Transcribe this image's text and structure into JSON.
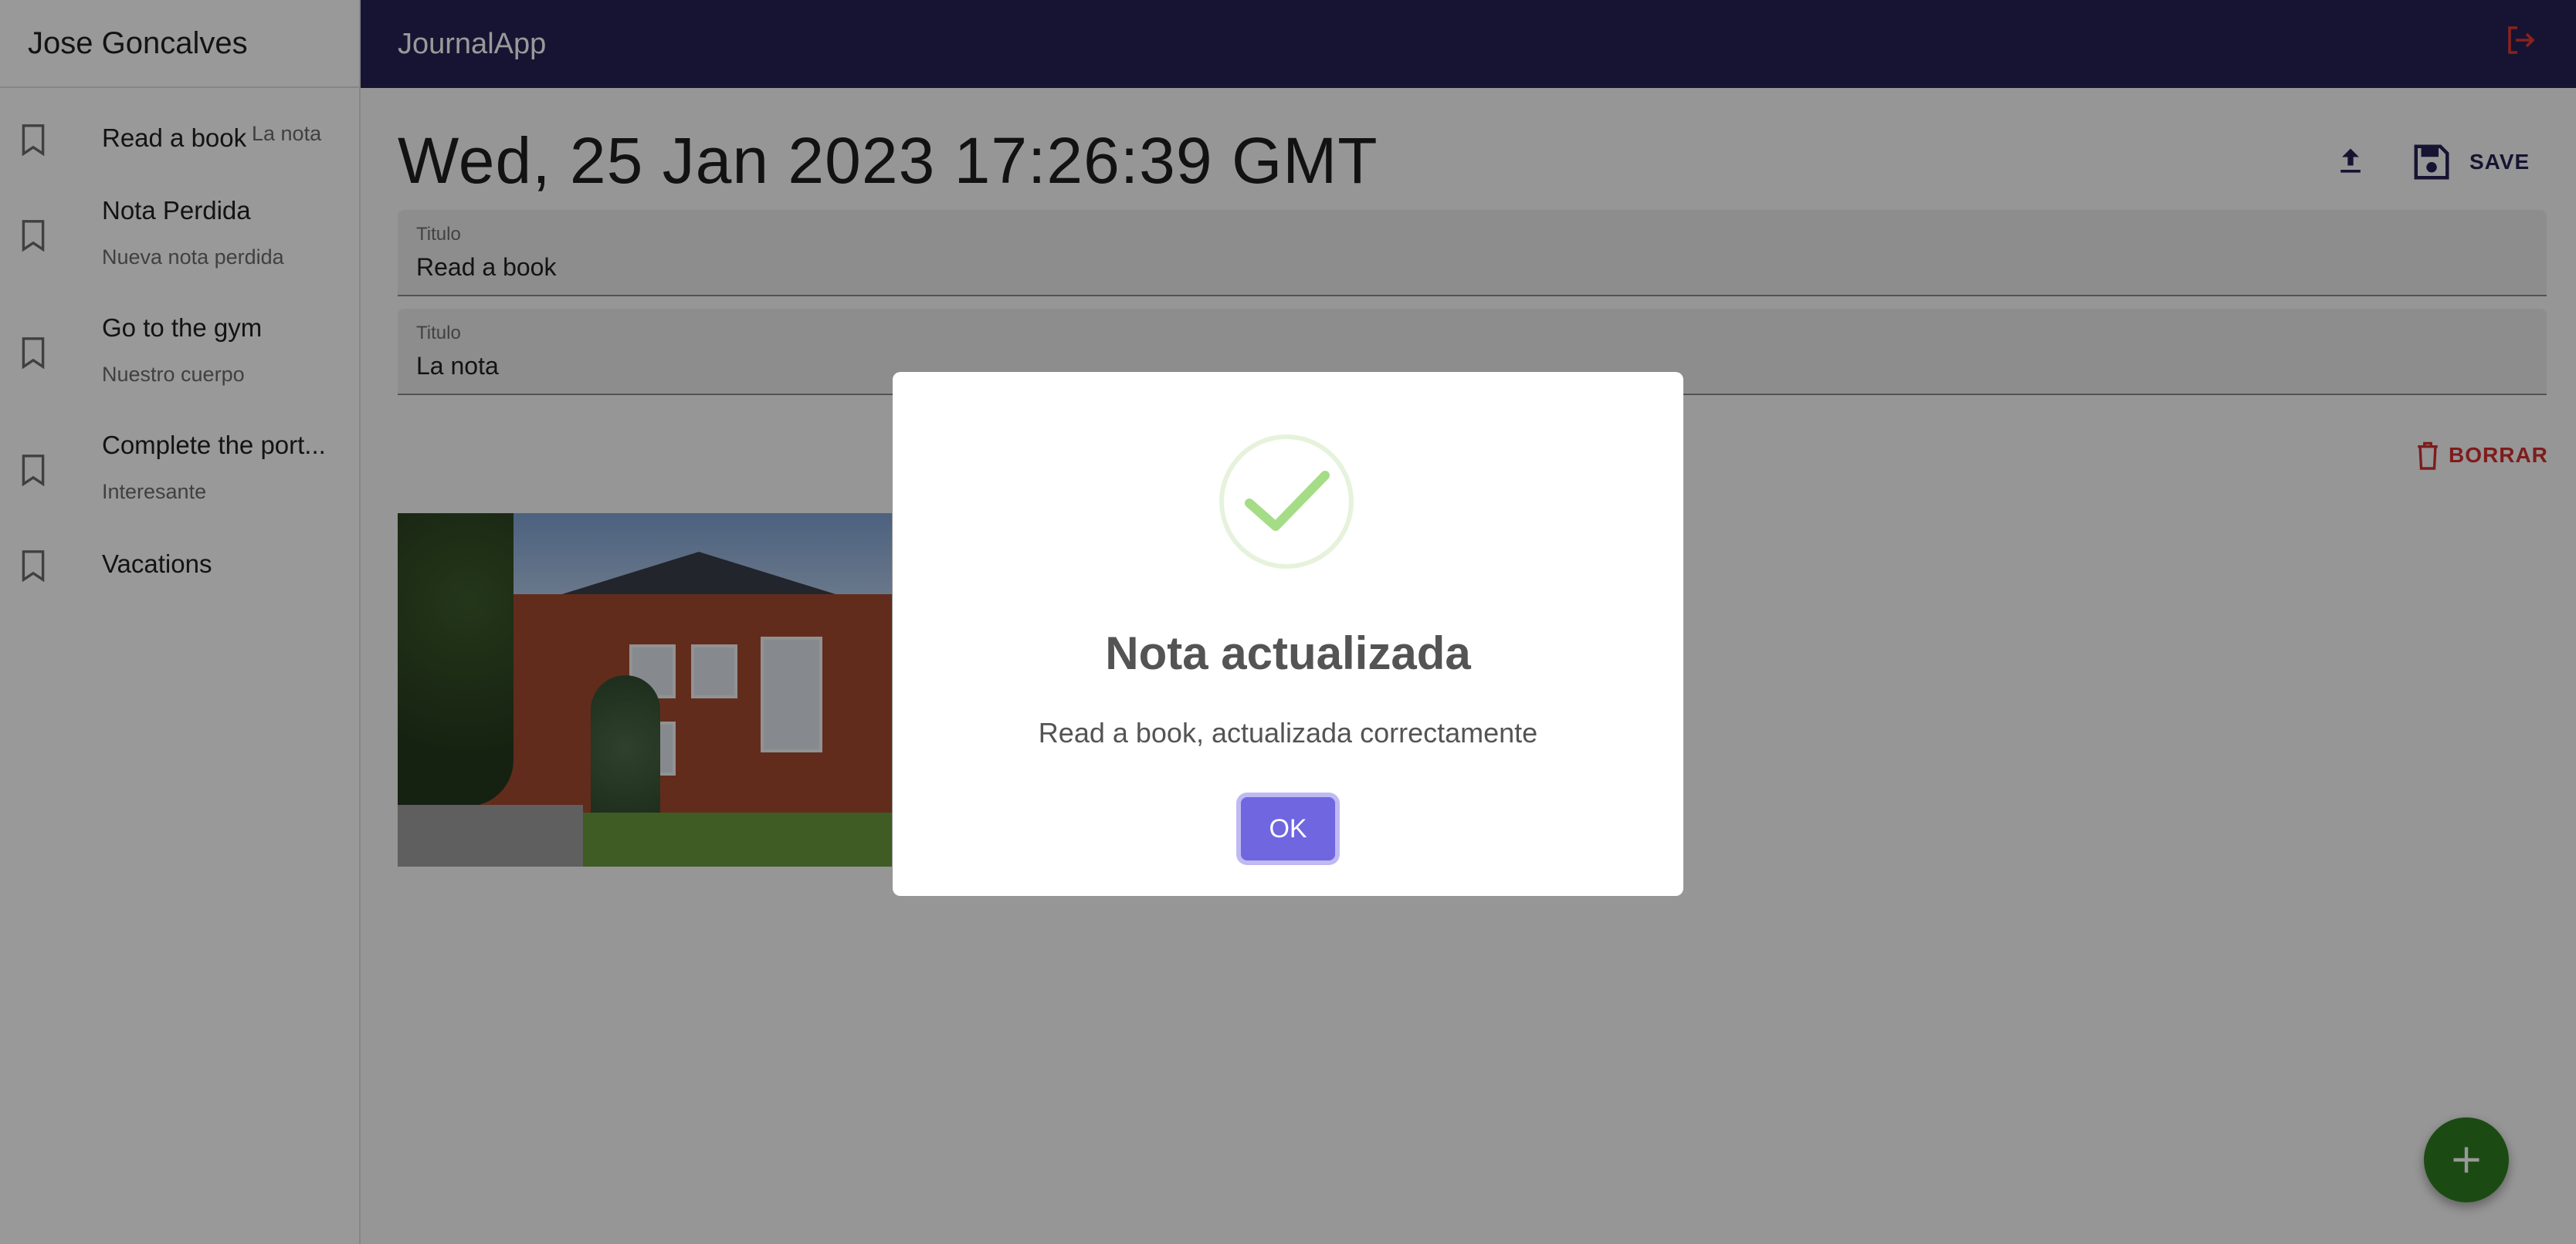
{
  "sidebar": {
    "user_name": "Jose Goncalves",
    "items": [
      {
        "title": "Read a book",
        "subtitle": "La nota"
      },
      {
        "title": "Nota Perdida",
        "subtitle": "Nueva nota perdida"
      },
      {
        "title": "Go to the gym",
        "subtitle": "Nuestro cuerpo"
      },
      {
        "title": "Complete the port...",
        "subtitle": "Interesante"
      },
      {
        "title": "Vacations",
        "subtitle": ""
      }
    ]
  },
  "appbar": {
    "title": "JournalApp",
    "logout_icon": "logout-icon",
    "accent_color": "#262254",
    "logout_color": "#e53935"
  },
  "note": {
    "date": "Wed, 25 Jan 2023 17:26:39 GMT",
    "save_label": "SAVE",
    "title_field": {
      "label": "Titulo",
      "value": "Read a book"
    },
    "body_field": {
      "label": "Titulo",
      "value": "La nota"
    },
    "delete_label": "BORRAR",
    "fab_icon": "plus-icon"
  },
  "dialog": {
    "title": "Nota actualizada",
    "text": "Read a book, actualizada correctamente",
    "ok_label": "OK",
    "icon": "success-check-icon"
  }
}
